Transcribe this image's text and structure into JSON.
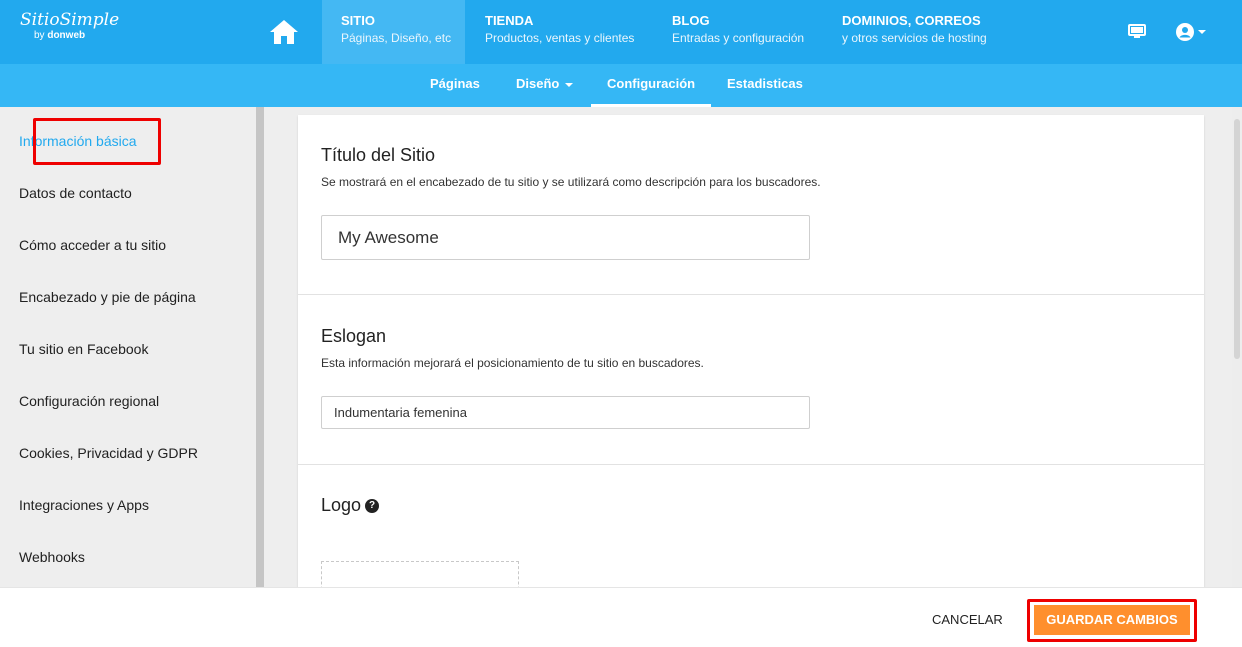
{
  "brand": {
    "logo_main": "SitioSimple",
    "logo_by": "by",
    "logo_company": "donweb"
  },
  "topnav": [
    {
      "title": "SITIO",
      "subtitle": "Páginas, Diseño, etc"
    },
    {
      "title": "TIENDA",
      "subtitle": "Productos, ventas y clientes"
    },
    {
      "title": "BLOG",
      "subtitle": "Entradas y configuración"
    },
    {
      "title": "DOMINIOS, CORREOS",
      "subtitle": "y otros servicios de hosting"
    }
  ],
  "subnav": [
    {
      "label": "Páginas"
    },
    {
      "label": "Diseño"
    },
    {
      "label": "Configuración"
    },
    {
      "label": "Estadisticas"
    }
  ],
  "sidebar": {
    "items": [
      {
        "label": "Información básica"
      },
      {
        "label": "Datos de contacto"
      },
      {
        "label": "Cómo acceder a tu sitio"
      },
      {
        "label": "Encabezado y pie de página"
      },
      {
        "label": "Tu sitio en Facebook"
      },
      {
        "label": "Configuración regional"
      },
      {
        "label": "Cookies, Privacidad y GDPR"
      },
      {
        "label": "Integraciones y Apps"
      },
      {
        "label": "Webhooks"
      }
    ]
  },
  "sections": {
    "title": {
      "heading": "Título del Sitio",
      "description": "Se mostrará en el encabezado de tu sitio y se utilizará como descripción para los buscadores.",
      "value": "My Awesome"
    },
    "slogan": {
      "heading": "Eslogan",
      "description": "Esta información mejorará el posicionamiento de tu sitio en buscadores.",
      "value": "Indumentaria femenina"
    },
    "logo": {
      "heading": "Logo",
      "help": "?"
    }
  },
  "footer": {
    "cancel_label": "CANCELAR",
    "save_label": "GUARDAR CAMBIOS"
  },
  "colors": {
    "topbar": "#22a9ee",
    "subbar": "#35b7f5",
    "accent": "#22a9ee",
    "save_button": "#ff8f2d",
    "highlight": "#ee0000"
  },
  "icons": {
    "home": "home-icon",
    "monitor": "monitor-icon",
    "user": "user-circle-icon",
    "help": "question-circle-icon"
  }
}
